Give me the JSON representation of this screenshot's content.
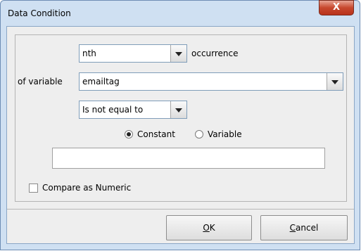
{
  "window": {
    "title": "Data Condition",
    "close_label": "X"
  },
  "condition": {
    "occurrence_select": "nth",
    "occurrence_suffix": "occurrence",
    "variable_label": "of variable",
    "variable_select": "emailtag",
    "operator_select": "Is not equal to"
  },
  "value_type": {
    "constant_label": "Constant",
    "variable_label": "Variable",
    "selected": "Constant"
  },
  "value_input": {
    "value": ""
  },
  "compare_numeric": {
    "label": "Compare as Numeric",
    "checked": false
  },
  "buttons": {
    "ok_mnemonic": "O",
    "ok_rest": "K",
    "cancel_mnemonic": "C",
    "cancel_rest": "ancel"
  }
}
